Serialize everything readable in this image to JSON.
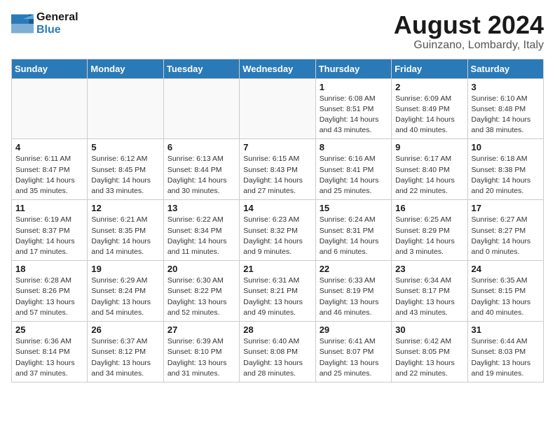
{
  "logo": {
    "line1": "General",
    "line2": "Blue"
  },
  "title": "August 2024",
  "location": "Guinzano, Lombardy, Italy",
  "days_of_week": [
    "Sunday",
    "Monday",
    "Tuesday",
    "Wednesday",
    "Thursday",
    "Friday",
    "Saturday"
  ],
  "weeks": [
    [
      {
        "day": "",
        "info": ""
      },
      {
        "day": "",
        "info": ""
      },
      {
        "day": "",
        "info": ""
      },
      {
        "day": "",
        "info": ""
      },
      {
        "day": "1",
        "info": "Sunrise: 6:08 AM\nSunset: 8:51 PM\nDaylight: 14 hours and 43 minutes."
      },
      {
        "day": "2",
        "info": "Sunrise: 6:09 AM\nSunset: 8:49 PM\nDaylight: 14 hours and 40 minutes."
      },
      {
        "day": "3",
        "info": "Sunrise: 6:10 AM\nSunset: 8:48 PM\nDaylight: 14 hours and 38 minutes."
      }
    ],
    [
      {
        "day": "4",
        "info": "Sunrise: 6:11 AM\nSunset: 8:47 PM\nDaylight: 14 hours and 35 minutes."
      },
      {
        "day": "5",
        "info": "Sunrise: 6:12 AM\nSunset: 8:45 PM\nDaylight: 14 hours and 33 minutes."
      },
      {
        "day": "6",
        "info": "Sunrise: 6:13 AM\nSunset: 8:44 PM\nDaylight: 14 hours and 30 minutes."
      },
      {
        "day": "7",
        "info": "Sunrise: 6:15 AM\nSunset: 8:43 PM\nDaylight: 14 hours and 27 minutes."
      },
      {
        "day": "8",
        "info": "Sunrise: 6:16 AM\nSunset: 8:41 PM\nDaylight: 14 hours and 25 minutes."
      },
      {
        "day": "9",
        "info": "Sunrise: 6:17 AM\nSunset: 8:40 PM\nDaylight: 14 hours and 22 minutes."
      },
      {
        "day": "10",
        "info": "Sunrise: 6:18 AM\nSunset: 8:38 PM\nDaylight: 14 hours and 20 minutes."
      }
    ],
    [
      {
        "day": "11",
        "info": "Sunrise: 6:19 AM\nSunset: 8:37 PM\nDaylight: 14 hours and 17 minutes."
      },
      {
        "day": "12",
        "info": "Sunrise: 6:21 AM\nSunset: 8:35 PM\nDaylight: 14 hours and 14 minutes."
      },
      {
        "day": "13",
        "info": "Sunrise: 6:22 AM\nSunset: 8:34 PM\nDaylight: 14 hours and 11 minutes."
      },
      {
        "day": "14",
        "info": "Sunrise: 6:23 AM\nSunset: 8:32 PM\nDaylight: 14 hours and 9 minutes."
      },
      {
        "day": "15",
        "info": "Sunrise: 6:24 AM\nSunset: 8:31 PM\nDaylight: 14 hours and 6 minutes."
      },
      {
        "day": "16",
        "info": "Sunrise: 6:25 AM\nSunset: 8:29 PM\nDaylight: 14 hours and 3 minutes."
      },
      {
        "day": "17",
        "info": "Sunrise: 6:27 AM\nSunset: 8:27 PM\nDaylight: 14 hours and 0 minutes."
      }
    ],
    [
      {
        "day": "18",
        "info": "Sunrise: 6:28 AM\nSunset: 8:26 PM\nDaylight: 13 hours and 57 minutes."
      },
      {
        "day": "19",
        "info": "Sunrise: 6:29 AM\nSunset: 8:24 PM\nDaylight: 13 hours and 54 minutes."
      },
      {
        "day": "20",
        "info": "Sunrise: 6:30 AM\nSunset: 8:22 PM\nDaylight: 13 hours and 52 minutes."
      },
      {
        "day": "21",
        "info": "Sunrise: 6:31 AM\nSunset: 8:21 PM\nDaylight: 13 hours and 49 minutes."
      },
      {
        "day": "22",
        "info": "Sunrise: 6:33 AM\nSunset: 8:19 PM\nDaylight: 13 hours and 46 minutes."
      },
      {
        "day": "23",
        "info": "Sunrise: 6:34 AM\nSunset: 8:17 PM\nDaylight: 13 hours and 43 minutes."
      },
      {
        "day": "24",
        "info": "Sunrise: 6:35 AM\nSunset: 8:15 PM\nDaylight: 13 hours and 40 minutes."
      }
    ],
    [
      {
        "day": "25",
        "info": "Sunrise: 6:36 AM\nSunset: 8:14 PM\nDaylight: 13 hours and 37 minutes."
      },
      {
        "day": "26",
        "info": "Sunrise: 6:37 AM\nSunset: 8:12 PM\nDaylight: 13 hours and 34 minutes."
      },
      {
        "day": "27",
        "info": "Sunrise: 6:39 AM\nSunset: 8:10 PM\nDaylight: 13 hours and 31 minutes."
      },
      {
        "day": "28",
        "info": "Sunrise: 6:40 AM\nSunset: 8:08 PM\nDaylight: 13 hours and 28 minutes."
      },
      {
        "day": "29",
        "info": "Sunrise: 6:41 AM\nSunset: 8:07 PM\nDaylight: 13 hours and 25 minutes."
      },
      {
        "day": "30",
        "info": "Sunrise: 6:42 AM\nSunset: 8:05 PM\nDaylight: 13 hours and 22 minutes."
      },
      {
        "day": "31",
        "info": "Sunrise: 6:44 AM\nSunset: 8:03 PM\nDaylight: 13 hours and 19 minutes."
      }
    ]
  ]
}
